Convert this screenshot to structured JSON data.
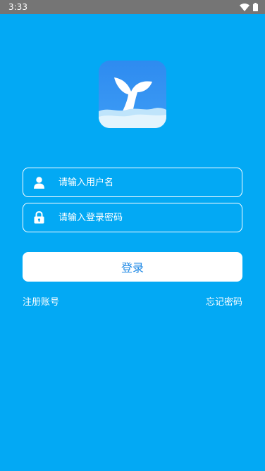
{
  "status_bar": {
    "time": "3:33",
    "icons": [
      "wifi-icon",
      "battery-icon"
    ]
  },
  "logo": {
    "icon": "whale-tail-icon"
  },
  "form": {
    "username": {
      "placeholder": "请输入用户名",
      "value": "",
      "icon": "user-icon"
    },
    "password": {
      "placeholder": "请输入登录密码",
      "value": "",
      "icon": "lock-icon"
    },
    "login_label": "登录"
  },
  "links": {
    "register": "注册账号",
    "forgot_password": "忘记密码"
  },
  "colors": {
    "background": "#03A9F4",
    "status_bar": "#757575",
    "button_bg": "#FFFFFF",
    "button_text": "#1E88E5",
    "logo_blue": "#2E8BF0"
  }
}
